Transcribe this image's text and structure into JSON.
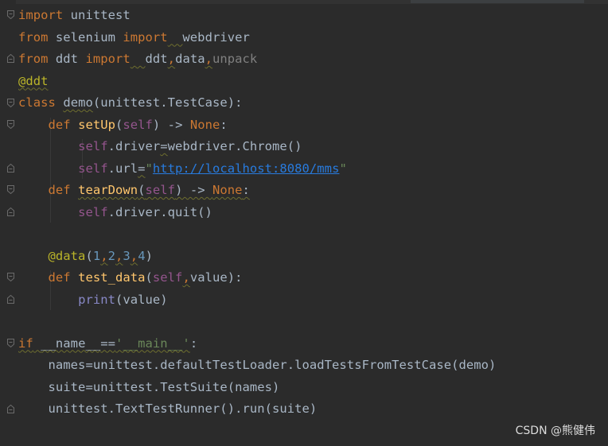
{
  "editor": {
    "lines": [
      [
        {
          "t": "import",
          "c": "kw"
        },
        {
          "t": " unittest",
          "c": "id"
        }
      ],
      [
        {
          "t": "from",
          "c": "kw"
        },
        {
          "t": " selenium ",
          "c": "id"
        },
        {
          "t": "import",
          "c": "kw"
        },
        {
          "t": "  ",
          "c": "id",
          "w": true
        },
        {
          "t": "webdriver",
          "c": "id"
        }
      ],
      [
        {
          "t": "from",
          "c": "kw"
        },
        {
          "t": " ddt ",
          "c": "id"
        },
        {
          "t": "import",
          "c": "kw"
        },
        {
          "t": "  ",
          "c": "id",
          "w": true
        },
        {
          "t": "ddt",
          "c": "id"
        },
        {
          "t": ",",
          "c": "kw",
          "w": true
        },
        {
          "t": "data",
          "c": "id"
        },
        {
          "t": ",",
          "c": "kw",
          "w": true
        },
        {
          "t": "unpack",
          "c": "dim"
        }
      ],
      [
        {
          "t": "@ddt",
          "c": "dec",
          "w": true
        }
      ],
      [
        {
          "t": "class",
          "c": "kw"
        },
        {
          "t": " ",
          "c": "id"
        },
        {
          "t": "demo",
          "c": "id",
          "w": true
        },
        {
          "t": "(unittest.TestCase):",
          "c": "id"
        }
      ],
      [
        {
          "t": "    ",
          "c": "id"
        },
        {
          "t": "def",
          "c": "kw"
        },
        {
          "t": " ",
          "c": "id"
        },
        {
          "t": "setUp",
          "c": "fn"
        },
        {
          "t": "(",
          "c": "id"
        },
        {
          "t": "self",
          "c": "self"
        },
        {
          "t": ") -> ",
          "c": "id"
        },
        {
          "t": "None",
          "c": "none"
        },
        {
          "t": ":",
          "c": "id"
        }
      ],
      [
        {
          "t": "        ",
          "c": "id"
        },
        {
          "t": "self",
          "c": "self"
        },
        {
          "t": ".driver",
          "c": "id"
        },
        {
          "t": "=",
          "c": "id",
          "w": true
        },
        {
          "t": "webdriver.Chrome()",
          "c": "id"
        }
      ],
      [
        {
          "t": "        ",
          "c": "id"
        },
        {
          "t": "self",
          "c": "self"
        },
        {
          "t": ".url",
          "c": "id"
        },
        {
          "t": "=",
          "c": "id",
          "w": true
        },
        {
          "t": "\"",
          "c": "str"
        },
        {
          "t": "http://localhost:8080/mms",
          "c": "url"
        },
        {
          "t": "\"",
          "c": "str"
        }
      ],
      [
        {
          "t": "    ",
          "c": "id"
        },
        {
          "t": "def",
          "c": "kw"
        },
        {
          "t": " ",
          "c": "id"
        },
        {
          "t": "tearDown",
          "c": "fn",
          "w": true
        },
        {
          "t": "(",
          "c": "id",
          "w": true
        },
        {
          "t": "self",
          "c": "self",
          "w": true
        },
        {
          "t": ") -> ",
          "c": "id",
          "w": true
        },
        {
          "t": "None",
          "c": "none",
          "w": true
        },
        {
          "t": ":",
          "c": "id",
          "w": true
        }
      ],
      [
        {
          "t": "        ",
          "c": "id"
        },
        {
          "t": "self",
          "c": "self"
        },
        {
          "t": ".driver.quit()",
          "c": "id"
        }
      ],
      [],
      [
        {
          "t": "    ",
          "c": "id"
        },
        {
          "t": "@data",
          "c": "dec"
        },
        {
          "t": "(",
          "c": "id"
        },
        {
          "t": "1",
          "c": "num"
        },
        {
          "t": ",",
          "c": "kw",
          "w": true
        },
        {
          "t": "2",
          "c": "num"
        },
        {
          "t": ",",
          "c": "kw",
          "w": true
        },
        {
          "t": "3",
          "c": "num"
        },
        {
          "t": ",",
          "c": "kw",
          "w": true
        },
        {
          "t": "4",
          "c": "num"
        },
        {
          "t": ")",
          "c": "id"
        }
      ],
      [
        {
          "t": "    ",
          "c": "id"
        },
        {
          "t": "def",
          "c": "kw"
        },
        {
          "t": " ",
          "c": "id"
        },
        {
          "t": "test_data",
          "c": "fn"
        },
        {
          "t": "(",
          "c": "id"
        },
        {
          "t": "self",
          "c": "self"
        },
        {
          "t": ",",
          "c": "kw",
          "w": true
        },
        {
          "t": "value):",
          "c": "id"
        }
      ],
      [
        {
          "t": "        ",
          "c": "id"
        },
        {
          "t": "print",
          "c": "builtin"
        },
        {
          "t": "(value)",
          "c": "id"
        }
      ],
      [],
      [
        {
          "t": "if",
          "c": "kw",
          "w": true
        },
        {
          "t": " ",
          "c": "id",
          "w": true
        },
        {
          "t": "__name__",
          "c": "id",
          "w": true
        },
        {
          "t": "==",
          "c": "id",
          "w": true
        },
        {
          "t": "'__main__'",
          "c": "str",
          "w": true
        },
        {
          "t": ":",
          "c": "id"
        }
      ],
      [
        {
          "t": "    names",
          "c": "id"
        },
        {
          "t": "=",
          "c": "id"
        },
        {
          "t": "unittest.defaultTestLoader.loadTestsFromTestCase(demo)",
          "c": "id"
        }
      ],
      [
        {
          "t": "    suite",
          "c": "id"
        },
        {
          "t": "=",
          "c": "id"
        },
        {
          "t": "unittest.TestSuite(names)",
          "c": "id"
        }
      ],
      [
        {
          "t": "    unittest.TextTestRunner().run(suite)",
          "c": "id"
        }
      ]
    ]
  },
  "watermark": "CSDN @熊健伟"
}
